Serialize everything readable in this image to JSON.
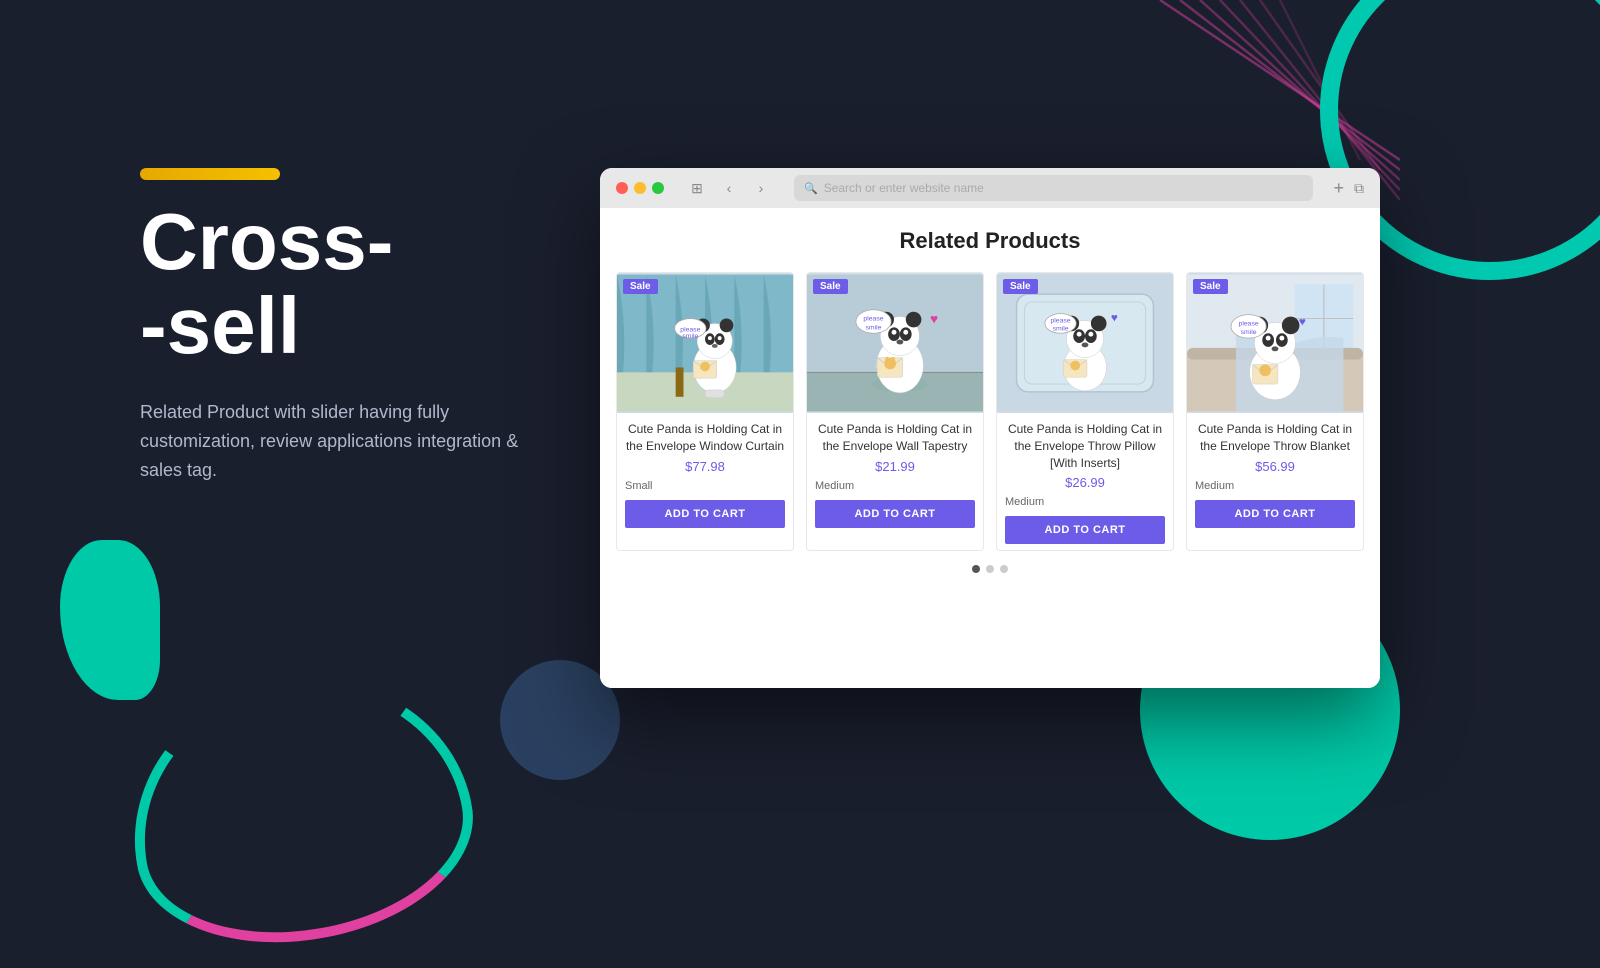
{
  "page": {
    "background_color": "#1a1f2e"
  },
  "left": {
    "title_line1": "Cross-",
    "title_line2": "-sell",
    "description": "Related Product with slider having fully customization, review applications integration & sales tag."
  },
  "browser": {
    "address_placeholder": "Search or enter website name",
    "content": {
      "section_title": "Related Products",
      "products": [
        {
          "name": "Cute Panda is Holding Cat in the Envelope Window Curtain",
          "price": "$77.98",
          "variant": "Small",
          "badge": "Sale",
          "add_to_cart": "ADD TO CART",
          "image_type": "curtain"
        },
        {
          "name": "Cute Panda is Holding Cat in the Envelope Wall Tapestry",
          "price": "$21.99",
          "variant": "Medium",
          "badge": "Sale",
          "add_to_cart": "ADD TO CART",
          "image_type": "tapestry"
        },
        {
          "name": "Cute Panda is Holding Cat in the Envelope Throw Pillow [With Inserts]",
          "price": "$26.99",
          "variant": "Medium",
          "badge": "Sale",
          "add_to_cart": "ADD TO CART",
          "image_type": "pillow"
        },
        {
          "name": "Cute Panda is Holding Cat in the Envelope Throw Blanket",
          "price": "$56.99",
          "variant": "Medium",
          "badge": "Sale",
          "add_to_cart": "ADD TO CART",
          "image_type": "blanket"
        }
      ],
      "slider_dots": 3,
      "active_dot": 0
    }
  }
}
